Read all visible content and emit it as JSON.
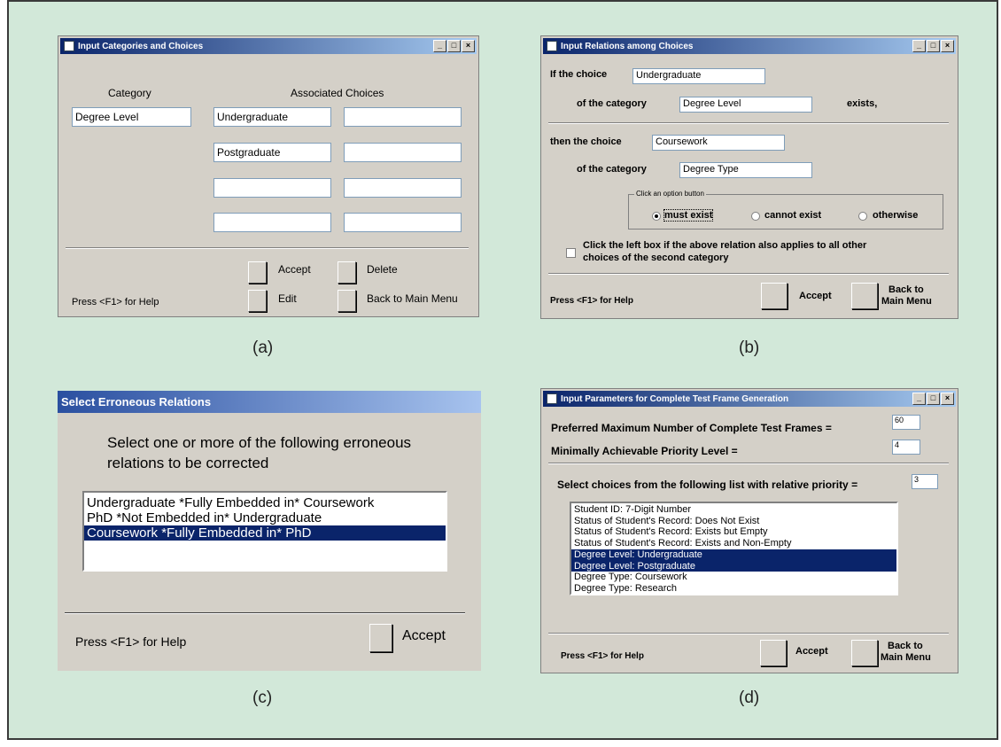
{
  "window_a": {
    "title": "Input Categories and Choices",
    "title_buttons": [
      "_",
      "□",
      "×"
    ],
    "category_header": "Category",
    "choices_header": "Associated Choices",
    "category_value": "Degree Level",
    "choices": [
      "Undergraduate",
      "",
      "Postgraduate",
      "",
      "",
      "",
      "",
      ""
    ],
    "buttons": {
      "accept": "Accept",
      "delete": "Delete",
      "edit": "Edit",
      "back": "Back to Main Menu"
    },
    "help": "Press <F1> for Help",
    "caption": "(a)"
  },
  "window_b": {
    "title": "Input Relations among Choices",
    "title_buttons": [
      "_",
      "□",
      "×"
    ],
    "if_choice_label": "If the choice",
    "if_choice_value": "Undergraduate",
    "of_category_label": "of the category",
    "if_category_value": "Degree Level",
    "exists_label": "exists,",
    "then_choice_label": "then the choice",
    "then_choice_value": "Coursework",
    "then_category_value": "Degree Type",
    "option_group_label": "Click an option button",
    "options": [
      {
        "label": "must exist",
        "selected": true
      },
      {
        "label": "cannot exist",
        "selected": false
      },
      {
        "label": "otherwise",
        "selected": false
      }
    ],
    "checkbox_label_1": "Click the left box if the above relation also applies to all other",
    "checkbox_label_2": "choices of the second category",
    "help": "Press <F1> for Help",
    "accept": "Accept",
    "back_1": "Back to",
    "back_2": "Main Menu",
    "caption": "(b)"
  },
  "window_c": {
    "title": "Select Erroneous Relations",
    "instruction_1": "Select one or more of the following erroneous",
    "instruction_2": "relations to be corrected",
    "items": [
      {
        "text": "Undergraduate *Fully Embedded in* Coursework",
        "selected": false
      },
      {
        "text": "PhD *Not Embedded in* Undergraduate",
        "selected": false
      },
      {
        "text": "Coursework *Fully Embedded in* PhD",
        "selected": true
      }
    ],
    "help": "Press <F1> for Help",
    "accept": "Accept",
    "caption": "(c)"
  },
  "window_d": {
    "title": "Input Parameters for Complete Test Frame Generation",
    "title_buttons": [
      "_",
      "□",
      "×"
    ],
    "max_frames_label": "Preferred Maximum Number of Complete Test Frames  =",
    "max_frames_value": "60",
    "priority_label": "Minimally Achievable Priority Level  =",
    "priority_value": "4",
    "select_label": "Select choices from the following list with relative priority =",
    "relative_priority_value": "3",
    "items": [
      {
        "text": "Student ID: 7-Digit Number",
        "selected": false
      },
      {
        "text": "Status of Student's Record: Does Not Exist",
        "selected": false
      },
      {
        "text": "Status of Student's Record: Exists but Empty",
        "selected": false
      },
      {
        "text": "Status of Student's Record: Exists and Non-Empty",
        "selected": false
      },
      {
        "text": "Degree Level: Undergraduate",
        "selected": true
      },
      {
        "text": "Degree Level: Postgraduate",
        "selected": true
      },
      {
        "text": "Degree Type: Coursework",
        "selected": false
      },
      {
        "text": "Degree Type: Research",
        "selected": false
      }
    ],
    "help": "Press <F1> for Help",
    "accept": "Accept",
    "back_1": "Back to",
    "back_2": "Main Menu",
    "caption": "(d)"
  }
}
